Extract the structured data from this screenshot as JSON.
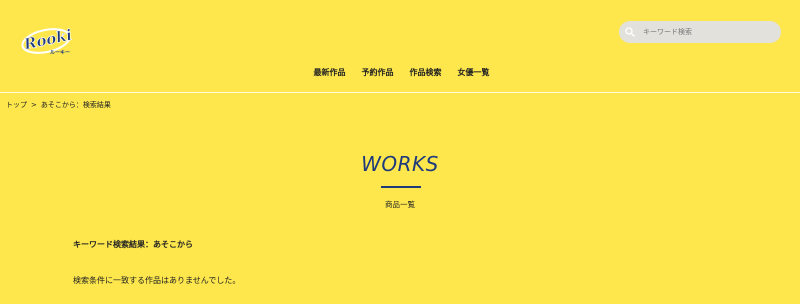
{
  "header": {
    "logo_text": "Rookie",
    "logo_sub": "ルーキー",
    "search_placeholder": "キーワード検索"
  },
  "nav": {
    "items": [
      "最新作品",
      "予約作品",
      "作品検索",
      "女優一覧"
    ]
  },
  "breadcrumb": {
    "home": "トップ",
    "separator": ">",
    "current": "あそこから：検索結果"
  },
  "section": {
    "title": "WORKS",
    "subtitle": "商品一覧"
  },
  "results": {
    "heading": "キーワード検索結果：あそこから",
    "message": "検索条件に一致する作品はありませんでした。"
  },
  "colors": {
    "background": "#fde74c",
    "accent": "#1e3a7b",
    "search_bg": "#e3e1dc"
  }
}
